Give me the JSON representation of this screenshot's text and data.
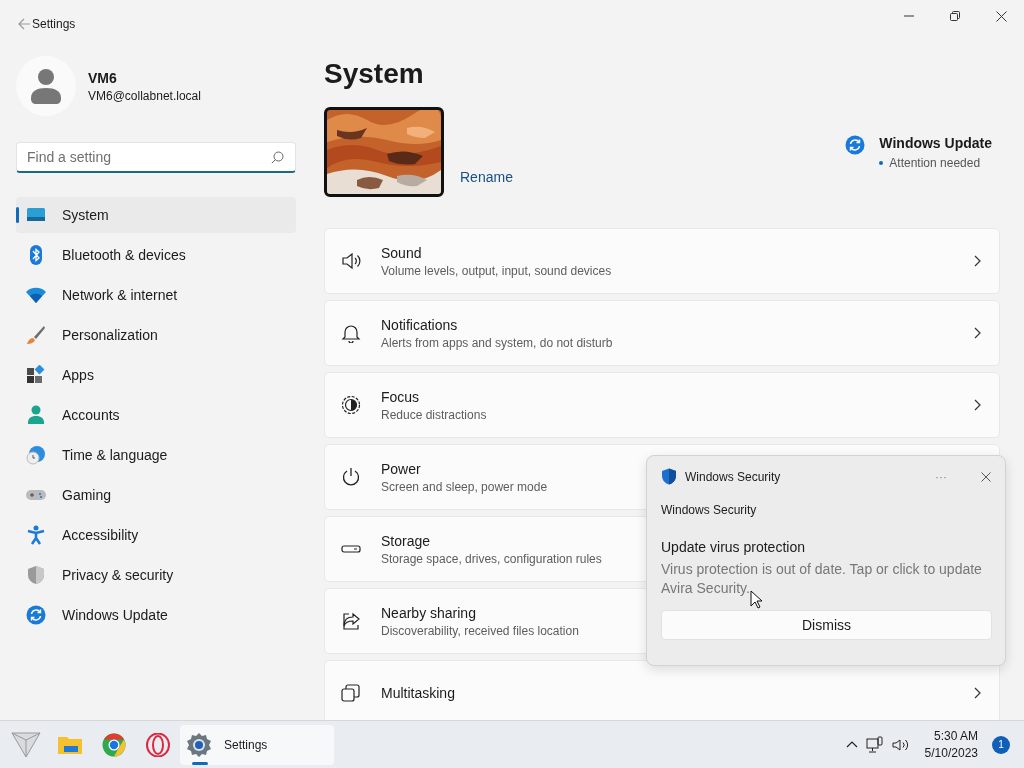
{
  "window": {
    "title": "Settings"
  },
  "user": {
    "name": "VM6",
    "email": "VM6@collabnet.local"
  },
  "search": {
    "placeholder": "Find a setting"
  },
  "sidebar": {
    "items": [
      {
        "label": "System",
        "selected": true
      },
      {
        "label": "Bluetooth & devices",
        "selected": false
      },
      {
        "label": "Network & internet",
        "selected": false
      },
      {
        "label": "Personalization",
        "selected": false
      },
      {
        "label": "Apps",
        "selected": false
      },
      {
        "label": "Accounts",
        "selected": false
      },
      {
        "label": "Time & language",
        "selected": false
      },
      {
        "label": "Gaming",
        "selected": false
      },
      {
        "label": "Accessibility",
        "selected": false
      },
      {
        "label": "Privacy & security",
        "selected": false
      },
      {
        "label": "Windows Update",
        "selected": false
      }
    ]
  },
  "page": {
    "title": "System",
    "rename": "Rename",
    "update": {
      "title": "Windows Update",
      "status": "Attention needed"
    }
  },
  "settings": [
    {
      "title": "Sound",
      "subtitle": "Volume levels, output, input, sound devices",
      "chevron": true
    },
    {
      "title": "Notifications",
      "subtitle": "Alerts from apps and system, do not disturb",
      "chevron": true
    },
    {
      "title": "Focus",
      "subtitle": "Reduce distractions",
      "chevron": true
    },
    {
      "title": "Power",
      "subtitle": "Screen and sleep, power mode",
      "chevron": false
    },
    {
      "title": "Storage",
      "subtitle": "Storage space, drives, configuration rules",
      "chevron": false
    },
    {
      "title": "Nearby sharing",
      "subtitle": "Discoverability, received files location",
      "chevron": false
    },
    {
      "title": "Multitasking",
      "chevron": true
    }
  ],
  "toast": {
    "app": "Windows Security",
    "more": "···",
    "source": "Windows Security",
    "title": "Update virus protection",
    "body": "Virus protection is out of date. Tap or click to update Avira Security.",
    "button": "Dismiss"
  },
  "taskbar": {
    "apps": [
      {
        "running": false
      },
      {
        "running": false
      },
      {
        "running": false
      },
      {
        "running": false
      },
      {
        "label": "Settings",
        "running": true
      }
    ],
    "time": "5:30 AM",
    "date": "5/10/2023",
    "badge": "1"
  }
}
